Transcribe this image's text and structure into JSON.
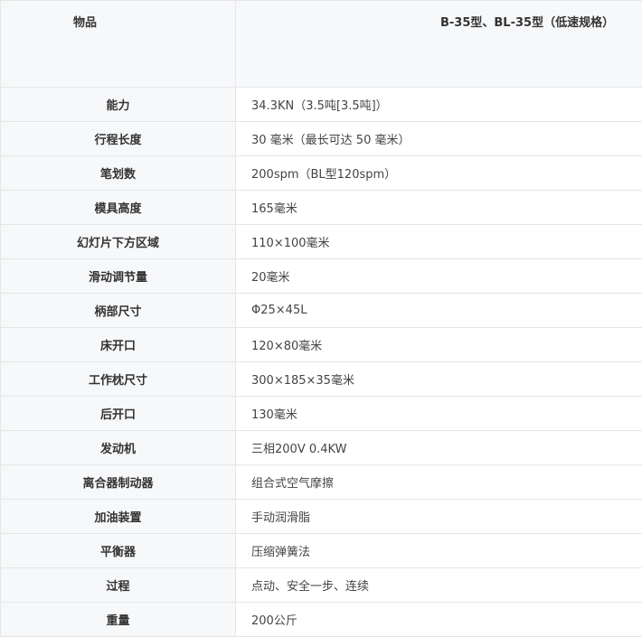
{
  "table": {
    "header": {
      "label": "物品",
      "value": "B-35型、BL-35型（低速规格）"
    },
    "rows": [
      {
        "label": "能力",
        "value": "34.3KN（3.5吨[3.5吨]）"
      },
      {
        "label": "行程长度",
        "value": "30 毫米（最长可达 50 毫米）"
      },
      {
        "label": "笔划数",
        "value": "200spm（BL型120spm）"
      },
      {
        "label": "模具高度",
        "value": "165毫米"
      },
      {
        "label": "幻灯片下方区域",
        "value": "110×100毫米"
      },
      {
        "label": "滑动调节量",
        "value": "20毫米"
      },
      {
        "label": "柄部尺寸",
        "value": "Φ25×45L"
      },
      {
        "label": "床开口",
        "value": "120×80毫米"
      },
      {
        "label": "工作枕尺寸",
        "value": "300×185×35毫米"
      },
      {
        "label": "后开口",
        "value": "130毫米"
      },
      {
        "label": "发动机",
        "value": "三相200V 0.4KW"
      },
      {
        "label": "离合器制动器",
        "value": "组合式空气摩擦"
      },
      {
        "label": "加油装置",
        "value": "手动润滑脂"
      },
      {
        "label": "平衡器",
        "value": "压缩弹簧法"
      },
      {
        "label": "过程",
        "value": "点动、安全一步、连续"
      },
      {
        "label": "重量",
        "value": "200公斤"
      }
    ]
  }
}
